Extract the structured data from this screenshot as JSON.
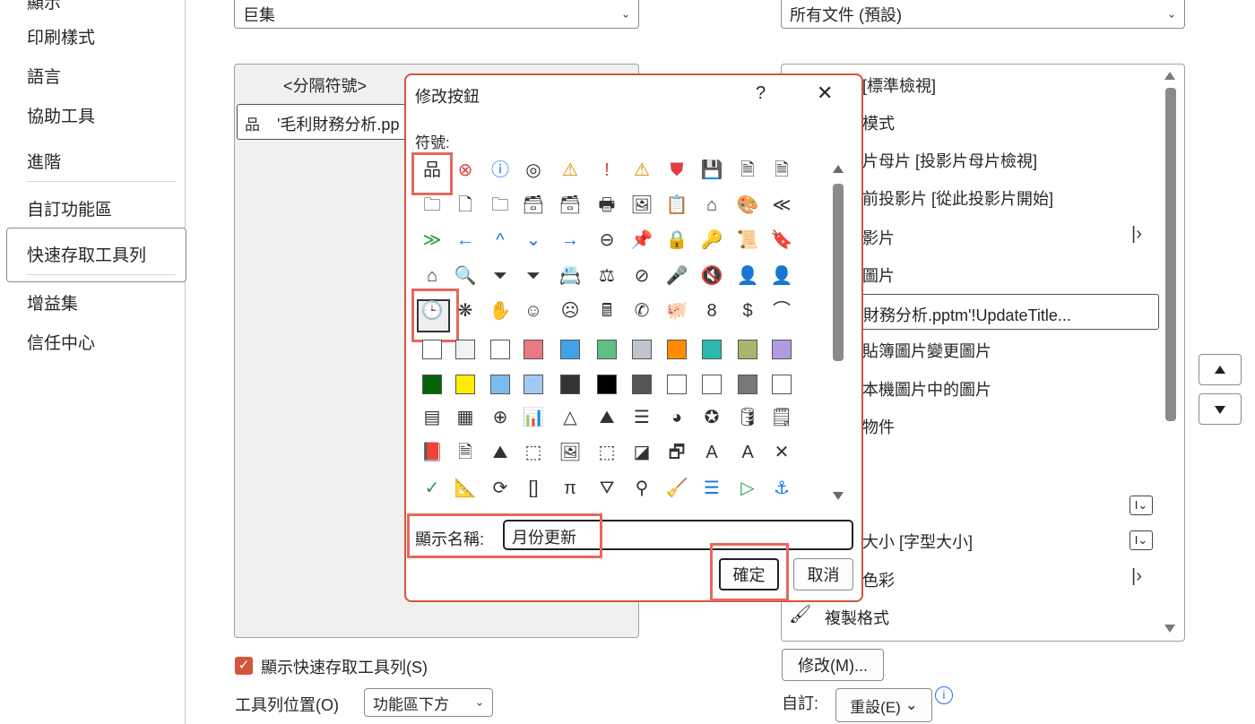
{
  "nav": {
    "top_cut": "顯示",
    "items": [
      "印刷樣式",
      "語言",
      "協助工具",
      "進階",
      "自訂功能區",
      "快速存取工具列",
      "增益集",
      "信任中心"
    ]
  },
  "left_combo": {
    "value": "巨集"
  },
  "right_combo": {
    "value": "所有文件 (預設)"
  },
  "left_list": {
    "separator": "<分隔符號>",
    "item_macro": "'毛利財務分析.pp"
  },
  "right_list": {
    "items": [
      "[標準檢視]",
      "模式",
      "片母片 [投影片母片檢視]",
      "前投影片 [從此投影片開始]",
      "影片",
      "圖片",
      "財務分析.pptm'!UpdateTitle...",
      "貼簿圖片變更圖片",
      "本機圖片中的圖片",
      "物件",
      "",
      "",
      "大小 [字型大小]",
      "色彩",
      "複製格式"
    ]
  },
  "dialog": {
    "title": "修改按鈕",
    "help": "?",
    "close": "✕",
    "symbol_label": "符號:",
    "display_name_label": "顯示名稱:",
    "display_name_value": "月份更新",
    "ok": "確定",
    "cancel": "取消"
  },
  "icons_row1": [
    "品",
    "⊗",
    "ⓘ",
    "◎",
    "⚠",
    "!",
    "⚠",
    "⛊",
    "💾",
    "🗎",
    "🗎"
  ],
  "icons_row2": [
    "🗀",
    "🗋",
    "🗀",
    "🗃",
    "🗃",
    "🖶",
    "🖼",
    "📋",
    "⌂",
    "🎨",
    "≪"
  ],
  "icons_row3": [
    "≫",
    "←",
    "^",
    "⌄",
    "→",
    "⊖",
    "📌",
    "🔒",
    "🔑",
    "📜",
    "🔖"
  ],
  "icons_row4": [
    "⌂",
    "🔍",
    "⏷",
    "⏷",
    "📇",
    "⚖",
    "⊘",
    "🎤",
    "🔇",
    "👤",
    "👤"
  ],
  "icons_row5": [
    "🕒",
    "❋",
    "✋",
    "☺",
    "☹",
    "🖩",
    "✆",
    "🐖",
    "8",
    "$",
    "⌒"
  ],
  "icons_row9": [
    "▤",
    "▦",
    "⊕",
    "📊",
    "△",
    "⛰",
    "☰",
    "◕",
    "✪",
    "🛢",
    "🗒"
  ],
  "icons_row10": [
    "📕",
    "🗎",
    "⛰",
    "⬚",
    "🖼",
    "⬚",
    "◪",
    "🗗",
    "A",
    "A",
    "✕"
  ],
  "icons_row11": [
    "✓",
    "📐",
    "⟳",
    "[]",
    "π",
    "⛛",
    "⚲",
    "🧹",
    "☰",
    "▷",
    "⚓"
  ],
  "swatch_row6": [
    "#ffffff",
    "#f2f2f2",
    "#ffffff",
    "#ea7983",
    "#43a2e6",
    "#5fbf84",
    "#bec4cc",
    "#ff8c00",
    "#2bb8ae",
    "#a8b56b",
    "#b09ae0"
  ],
  "swatch_row7": [
    "#006400",
    "#ffee00",
    "#7bbcf0",
    "#a3c9f2",
    "#333333",
    "#000000",
    "#555555",
    "#ffffff",
    "#ffffff",
    "#777777",
    "#ffffff"
  ],
  "colors": {
    "accent": "#d2553c",
    "highlight": "#e8675a",
    "check": "#d2553c",
    "info": "#1a73e8"
  },
  "bottom": {
    "show_qat_label": "顯示快速存取工具列(S)",
    "toolbar_pos_label": "工具列位置(O)",
    "toolbar_pos_value": "功能區下方",
    "modify_button": "修改(M)...",
    "custom_label": "自訂:",
    "reset_button": "重設(E)"
  }
}
